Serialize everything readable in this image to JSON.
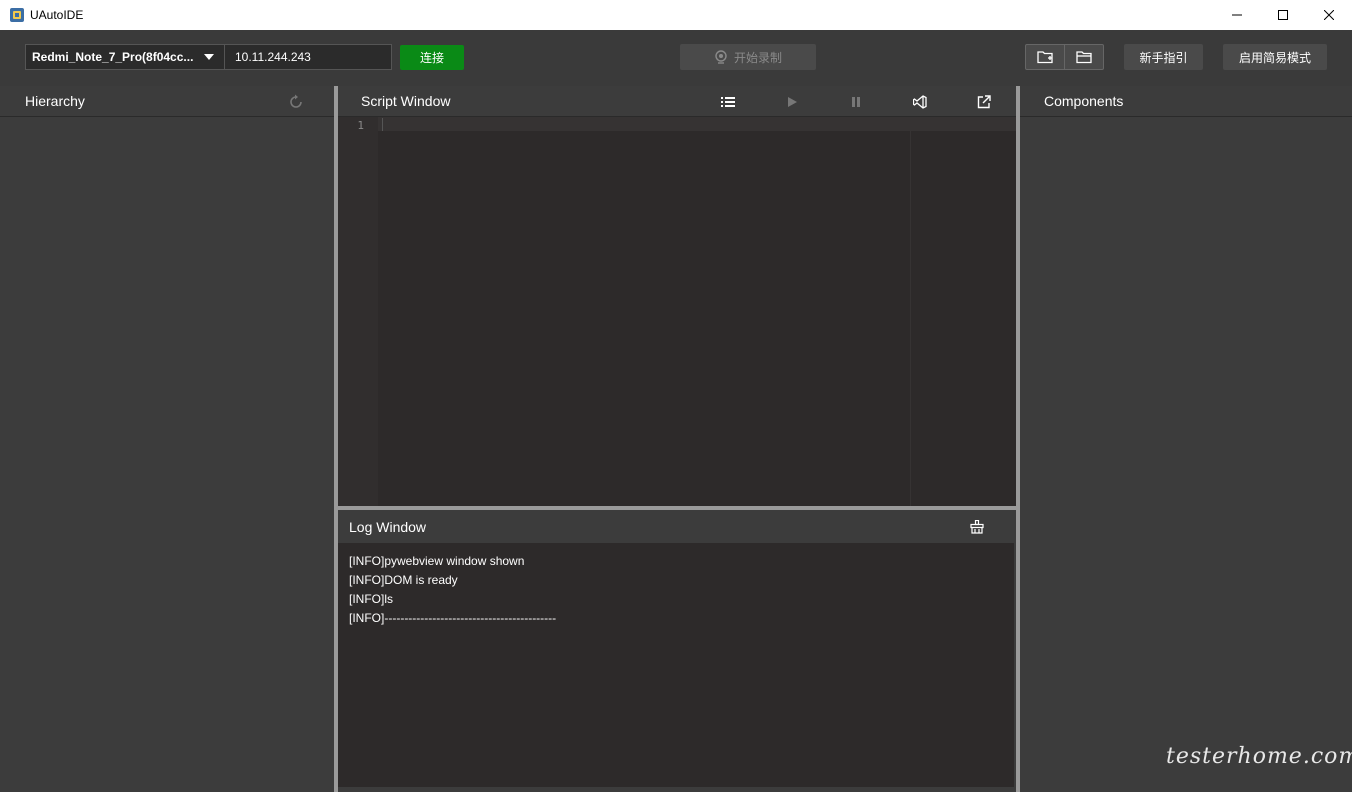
{
  "window": {
    "title": "UAutoIDE"
  },
  "toolbar": {
    "device": "Redmi_Note_7_Pro(8f04cc...",
    "ip": "10.11.244.243",
    "connect_label": "连接",
    "record_label": "开始录制",
    "guide_label": "新手指引",
    "simple_mode_label": "启用简易模式"
  },
  "hierarchy": {
    "title": "Hierarchy"
  },
  "script": {
    "title": "Script Window",
    "line_numbers": [
      "1"
    ]
  },
  "log": {
    "title": "Log Window",
    "lines": [
      "[INFO]pywebview window shown",
      "[INFO]DOM is ready",
      "[INFO]ls",
      "[INFO]-------------------------------------------"
    ]
  },
  "components": {
    "title": "Components"
  },
  "watermark": "testerhome.com"
}
